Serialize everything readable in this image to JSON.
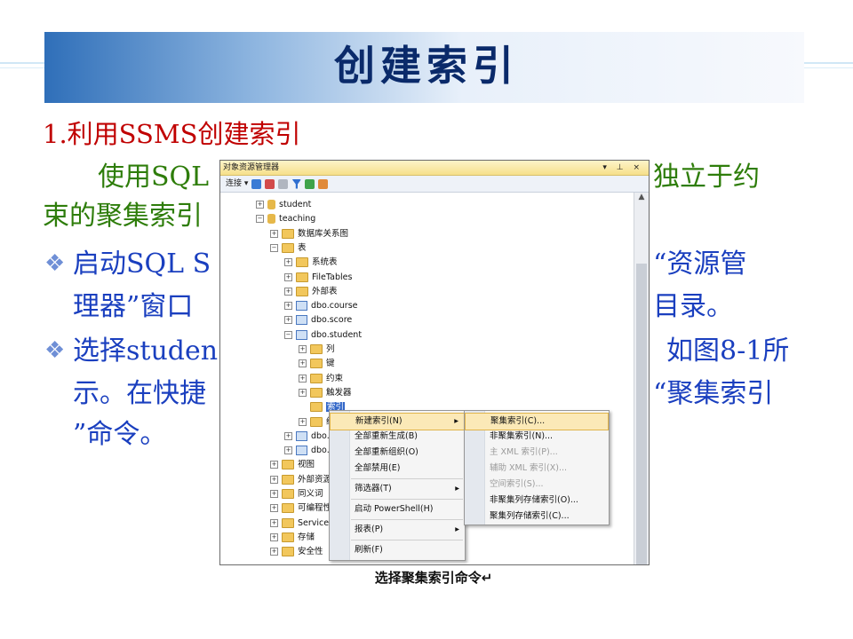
{
  "slide": {
    "title": "创建索引",
    "heading": "1.利用SSMS创建索引",
    "intro_line1_left": "使用SQL",
    "intro_line1_right": "独立于约",
    "intro_line2": "束的聚集索引",
    "bullet1_line1_left": "启动SQL S",
    "bullet1_line1_right": "“资源管",
    "bullet1_line2_left": "理器”窗口",
    "bullet1_line2_right": "目录。",
    "bullet2_line1_left": "选择studen",
    "bullet2_line1_right": "如图8-1所",
    "bullet2_line2_left": "示。在快捷",
    "bullet2_line2_right": "“聚集索引",
    "bullet2_line3": "”命令。",
    "caption": "选择聚集索引命令↵"
  },
  "explorer": {
    "title": "对象资源管理器",
    "title_controls": "▾ ⊥ ×",
    "connect_label": "连接 ▾",
    "tree": [
      {
        "label": "student",
        "kind": "db",
        "level": 1,
        "expander": "+"
      },
      {
        "label": "teaching",
        "kind": "db",
        "level": 1,
        "expander": "−"
      },
      {
        "label": "数据库关系图",
        "kind": "folder",
        "level": 2,
        "expander": "+"
      },
      {
        "label": "表",
        "kind": "folder",
        "level": 2,
        "expander": "−"
      },
      {
        "label": "系统表",
        "kind": "folder",
        "level": 3,
        "expander": "+"
      },
      {
        "label": "FileTables",
        "kind": "folder",
        "level": 3,
        "expander": "+"
      },
      {
        "label": "外部表",
        "kind": "folder",
        "level": 3,
        "expander": "+"
      },
      {
        "label": "dbo.course",
        "kind": "table",
        "level": 3,
        "expander": "+"
      },
      {
        "label": "dbo.score",
        "kind": "table",
        "level": 3,
        "expander": "+"
      },
      {
        "label": "dbo.student",
        "kind": "table",
        "level": 3,
        "expander": "−"
      },
      {
        "label": "列",
        "kind": "folder",
        "level": 4,
        "expander": "+"
      },
      {
        "label": "键",
        "kind": "folder",
        "level": 4,
        "expander": "+"
      },
      {
        "label": "约束",
        "kind": "folder",
        "level": 4,
        "expander": "+"
      },
      {
        "label": "触发器",
        "kind": "folder",
        "level": 4,
        "expander": "+"
      },
      {
        "label": "索引",
        "kind": "folder",
        "level": 4,
        "expander": "",
        "selected": true
      },
      {
        "label": "统",
        "kind": "folder",
        "level": 4,
        "expander": "+"
      },
      {
        "label": "dbo.",
        "kind": "table",
        "level": 3,
        "expander": "+"
      },
      {
        "label": "dbo.",
        "kind": "table",
        "level": 3,
        "expander": "+"
      },
      {
        "label": "视图",
        "kind": "folder",
        "level": 2,
        "expander": "+"
      },
      {
        "label": "外部资源",
        "kind": "folder",
        "level": 2,
        "expander": "+"
      },
      {
        "label": "同义词",
        "kind": "folder",
        "level": 2,
        "expander": "+"
      },
      {
        "label": "可编程性",
        "kind": "folder",
        "level": 2,
        "expander": "+"
      },
      {
        "label": "Service",
        "kind": "folder",
        "level": 2,
        "expander": "+"
      },
      {
        "label": "存储",
        "kind": "folder",
        "level": 2,
        "expander": "+"
      },
      {
        "label": "安全性",
        "kind": "folder",
        "level": 2,
        "expander": "+"
      }
    ]
  },
  "context_menu": {
    "items": [
      {
        "label": "新建索引(N)",
        "submenu": true,
        "highlighted": true
      },
      {
        "label": "全部重新生成(B)"
      },
      {
        "label": "全部重新组织(O)"
      },
      {
        "label": "全部禁用(E)"
      },
      {
        "separator": true
      },
      {
        "label": "筛选器(T)",
        "submenu": true
      },
      {
        "separator": true
      },
      {
        "label": "启动 PowerShell(H)"
      },
      {
        "separator": true
      },
      {
        "label": "报表(P)",
        "submenu": true
      },
      {
        "separator": true
      },
      {
        "label": "刷新(F)"
      }
    ]
  },
  "submenu": {
    "items": [
      {
        "label": "聚集索引(C)...",
        "highlighted": true
      },
      {
        "label": "非聚集索引(N)..."
      },
      {
        "label": "主 XML 索引(P)...",
        "disabled": true
      },
      {
        "label": "辅助 XML 索引(X)...",
        "disabled": true
      },
      {
        "label": "空间索引(S)...",
        "disabled": true
      },
      {
        "label": "非聚集列存储索引(O)..."
      },
      {
        "label": "聚集列存储索引(C)..."
      }
    ]
  }
}
